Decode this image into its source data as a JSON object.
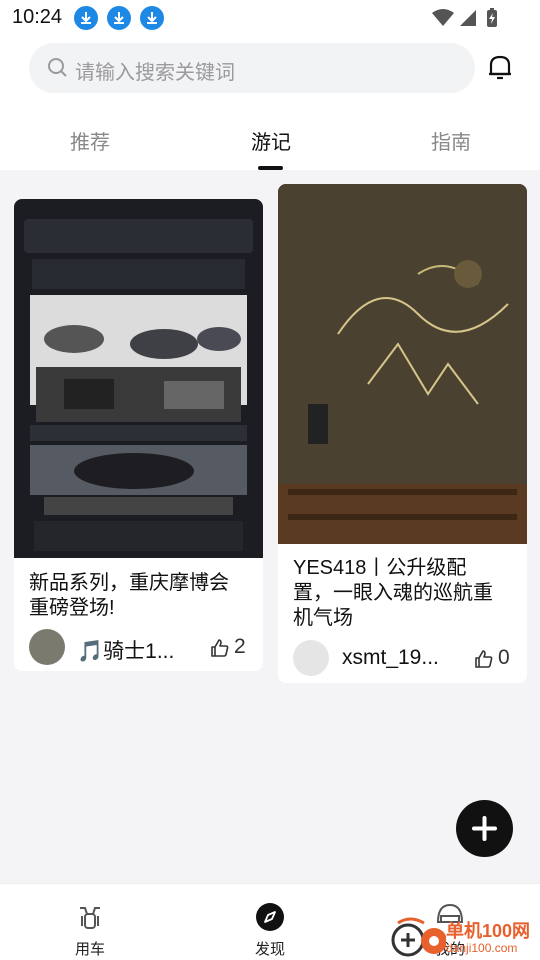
{
  "status_bar": {
    "time": "10:24"
  },
  "search": {
    "placeholder": "请输入搜索关键词"
  },
  "tabs": [
    {
      "label": "推荐"
    },
    {
      "label": "游记"
    },
    {
      "label": "指南"
    }
  ],
  "active_tab": "游记",
  "cards": [
    {
      "title_line1": "新品系列，重庆摩博会",
      "title_line2": "重磅登场!",
      "author": "🎵骑士1...",
      "likes": "2"
    },
    {
      "title_line1": "YES418丨公升级配",
      "title_line2": "置，一眼入魂的巡航重",
      "title_line3": "机气场",
      "author": "xsmt_19...",
      "likes": "0"
    }
  ],
  "bottom_nav": [
    {
      "label": "用车"
    },
    {
      "label": "发现"
    },
    {
      "label": "我的"
    }
  ],
  "watermark": {
    "line1": "单机100网",
    "line2": "danji100.com"
  },
  "colors": {
    "download_blue": "#1e88e5",
    "fab": "#111111",
    "watermark": "#e8602c"
  }
}
